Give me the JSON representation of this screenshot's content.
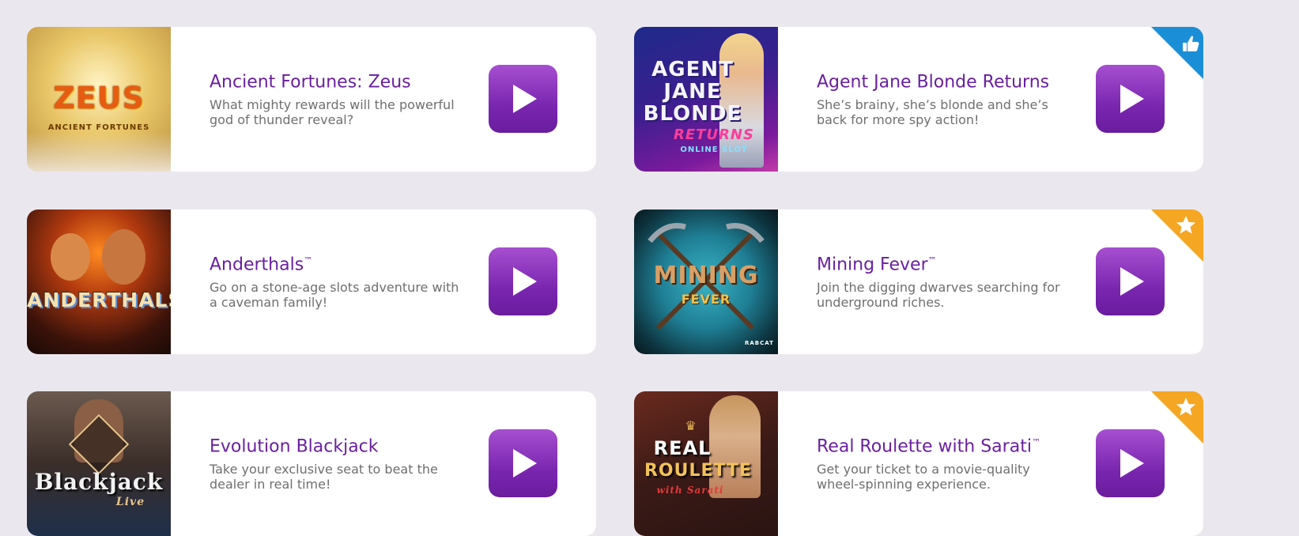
{
  "games": [
    {
      "title": "Ancient Fortunes: Zeus",
      "tm": "",
      "description": "What mighty rewards will the powerful god of thunder reveal?",
      "thumb_text_main": "ZEUS",
      "thumb_text_sub": "ANCIENT FORTUNES",
      "ribbon": "none"
    },
    {
      "title": "Agent Jane Blonde Returns",
      "tm": "",
      "description": "She’s brainy, she’s blonde and she’s back for more spy action!",
      "thumb_text_main": "AGENT JANE BLONDE",
      "thumb_text_sub": "RETURNS",
      "thumb_text_extra": "ONLINE SLOT",
      "ribbon": "thumbs-up",
      "ribbon_color": "#1a8fd8"
    },
    {
      "title": "Anderthals",
      "tm": "™",
      "description": "Go on a stone-age slots adventure with a caveman family!",
      "thumb_text_main": "ANDERTHALS",
      "ribbon": "none"
    },
    {
      "title": "Mining Fever",
      "tm": "™",
      "description": "Join the digging dwarves searching for underground riches.",
      "thumb_text_main": "MINING",
      "thumb_text_sub": "FEVER",
      "thumb_text_extra": "RABCAT",
      "ribbon": "star",
      "ribbon_color": "#f5a623"
    },
    {
      "title": "Evolution Blackjack",
      "tm": "",
      "description": "Take your exclusive seat to beat the dealer in real time!",
      "thumb_text_main": "Blackjack",
      "thumb_text_sub": "Live",
      "ribbon": "none"
    },
    {
      "title": "Real Roulette with Sarati",
      "tm": "™",
      "description": "Get your ticket to a movie-quality wheel-spinning experience.",
      "thumb_text_main": "REAL",
      "thumb_text_sub": "ROULETTE",
      "thumb_text_extra": "with Sarati",
      "ribbon": "star",
      "ribbon_color": "#f5a623"
    }
  ],
  "colors": {
    "accent": "#6a1fa0",
    "play_button": "#8a2fc0",
    "background": "#ebe7ee"
  }
}
